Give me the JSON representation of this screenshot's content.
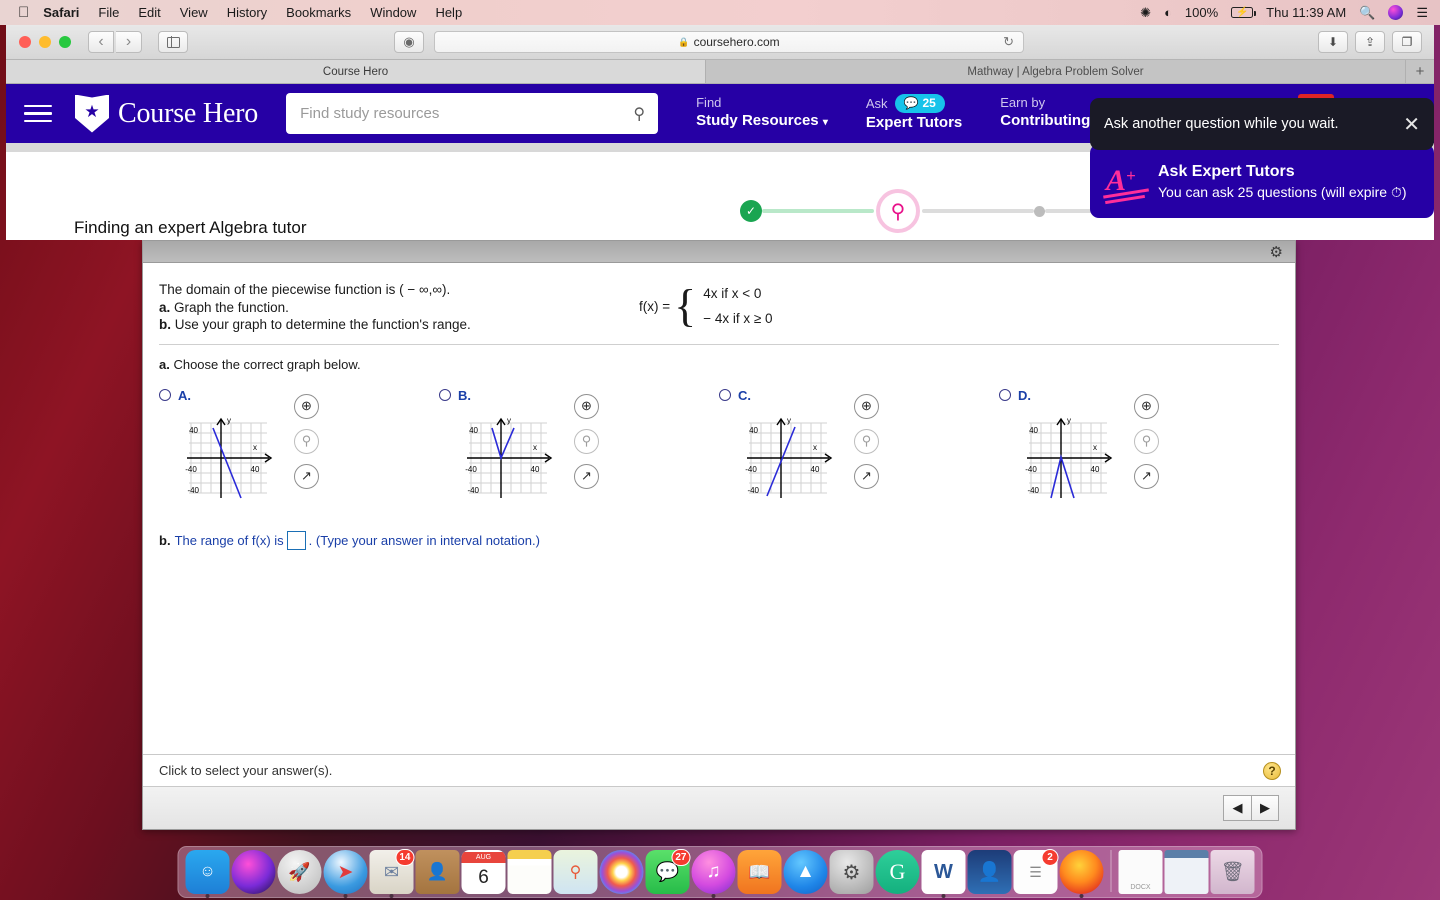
{
  "menubar": {
    "apple_icon": "apple-icon",
    "items": [
      "Safari",
      "File",
      "Edit",
      "View",
      "History",
      "Bookmarks",
      "Window",
      "Help"
    ],
    "status": {
      "bluetooth_icon": "bluetooth-icon",
      "wifi_icon": "wifi-icon",
      "battery_percent": "100%",
      "battery_icon": "battery-charging-icon",
      "clock": "Thu 11:39 AM",
      "spotlight_icon": "search-icon",
      "siri_icon": "siri-icon",
      "controlcenter_icon": "list-icon"
    }
  },
  "browser": {
    "back_icon": "chevron-left-icon",
    "forward_icon": "chevron-right-icon",
    "sidebar_icon": "sidebar-icon",
    "reader_icon": "reader-icon",
    "url": "coursehero.com",
    "lock_icon": "lock-icon",
    "reload_icon": "reload-icon",
    "downloads_icon": "download-icon",
    "share_icon": "share-icon",
    "tabs_icon": "tab-overview-icon",
    "tabs": [
      {
        "label": "Course Hero",
        "active": true
      },
      {
        "label": "Mathway | Algebra Problem Solver",
        "active": false
      }
    ],
    "new_tab_label": "+"
  },
  "site_header": {
    "menu_icon": "hamburger-icon",
    "brand": "Course Hero",
    "brand_star_icon": "star-icon",
    "search_placeholder": "Find study resources",
    "search_value": "",
    "search_icon": "search-icon",
    "nav": [
      {
        "top": "Find",
        "bottom": "Study Resources",
        "chevron": "⌄",
        "badge": null
      },
      {
        "top": "Ask",
        "bottom": "Expert Tutors",
        "badge": "25",
        "badge_icon": "question-bubble-icon"
      },
      {
        "top": "Earn by",
        "bottom": "Contributing",
        "chevron": "⌄",
        "badge": null
      }
    ]
  },
  "popup": {
    "message": "Ask another question while you wait.",
    "close_icon": "close-icon",
    "logo_text": "A",
    "logo_plus": "+",
    "title": "Ask Expert Tutors",
    "subtitle": "You can ask 25 questions (will expire ⏱)"
  },
  "progress": {
    "page_title": "Finding an expert Algebra tutor",
    "step_done_icon": "check-icon",
    "step_active_icon": "search-icon",
    "step_pending_icon": "dot-icon"
  },
  "question": {
    "gear_icon": "gear-icon",
    "prompt_line1": "The domain of the piecewise function is ( − ∞,∞).",
    "prompt_a_bold": "a.",
    "prompt_a": " Graph the function.",
    "prompt_b_bold": "b.",
    "prompt_b": " Use your graph to determine the function's range.",
    "fx_label": "f(x) =",
    "case1": "4x  if  x < 0",
    "case2": "− 4x  if  x ≥ 0",
    "choose_bold": "a.",
    "choose_text": " Choose the correct graph below.",
    "options": [
      {
        "letter": "A.",
        "selected": false,
        "graph": "line-down-steep",
        "zoom_in_icon": "zoom-in-icon",
        "zoom_out_icon": "zoom-out-icon",
        "expand_icon": "open-external-icon"
      },
      {
        "letter": "B.",
        "selected": false,
        "graph": "v-shape-up",
        "zoom_in_icon": "zoom-in-icon",
        "zoom_out_icon": "zoom-out-icon",
        "expand_icon": "open-external-icon"
      },
      {
        "letter": "C.",
        "selected": false,
        "graph": "line-up-steep",
        "zoom_in_icon": "zoom-in-icon",
        "zoom_out_icon": "zoom-out-icon",
        "expand_icon": "open-external-icon"
      },
      {
        "letter": "D.",
        "selected": false,
        "graph": "v-shape-down",
        "zoom_in_icon": "zoom-in-icon",
        "zoom_out_icon": "zoom-out-icon",
        "expand_icon": "open-external-icon"
      }
    ],
    "graph_axis": {
      "x_label": "x",
      "y_label": "y",
      "x_min_tick": "-40",
      "x_max_tick": "40",
      "y_max_tick": "40",
      "y_min_tick": "-40"
    },
    "part_b_bold": "b.",
    "part_b_text1": " The range of f(x) is",
    "part_b_value": "",
    "part_b_text2": ". (Type your answer in interval notation.)",
    "footer_note": "Click to select your answer(s).",
    "help_icon": "question-mark-icon",
    "prev_icon": "triangle-left-icon",
    "next_icon": "triangle-right-icon"
  },
  "dock": {
    "items": [
      {
        "name": "finder",
        "badge": null,
        "running": true
      },
      {
        "name": "siri",
        "badge": null,
        "running": false
      },
      {
        "name": "launchpad",
        "badge": null,
        "running": false
      },
      {
        "name": "safari",
        "badge": null,
        "running": true
      },
      {
        "name": "mail",
        "badge": "14",
        "running": true
      },
      {
        "name": "contacts",
        "badge": null,
        "running": false
      },
      {
        "name": "calendar",
        "badge": null,
        "running": false,
        "month": "AUG",
        "day": "6"
      },
      {
        "name": "notes",
        "badge": null,
        "running": false
      },
      {
        "name": "maps",
        "badge": null,
        "running": false
      },
      {
        "name": "photos",
        "badge": null,
        "running": false
      },
      {
        "name": "messages",
        "badge": "27",
        "running": false
      },
      {
        "name": "itunes",
        "badge": null,
        "running": true
      },
      {
        "name": "ibooks",
        "badge": null,
        "running": false
      },
      {
        "name": "app-store",
        "badge": null,
        "running": false
      },
      {
        "name": "system-preferences",
        "badge": null,
        "running": false
      },
      {
        "name": "grammarly",
        "badge": null,
        "running": false
      },
      {
        "name": "word",
        "badge": null,
        "running": true
      },
      {
        "name": "kindle",
        "badge": null,
        "running": false
      },
      {
        "name": "reminders",
        "badge": "2",
        "running": false
      },
      {
        "name": "firefox",
        "badge": null,
        "running": true
      },
      {
        "name": "document-docx",
        "badge": null,
        "running": false
      },
      {
        "name": "downloads-stack",
        "badge": null,
        "running": false
      },
      {
        "name": "trash",
        "badge": null,
        "running": false
      }
    ]
  },
  "colors": {
    "brand_purple": "#2600a5",
    "accent_pink": "#ff2e9a",
    "badge_cyan": "#17c3ea",
    "success_green": "#1aa551",
    "graph_blue": "#2b2bd8"
  }
}
